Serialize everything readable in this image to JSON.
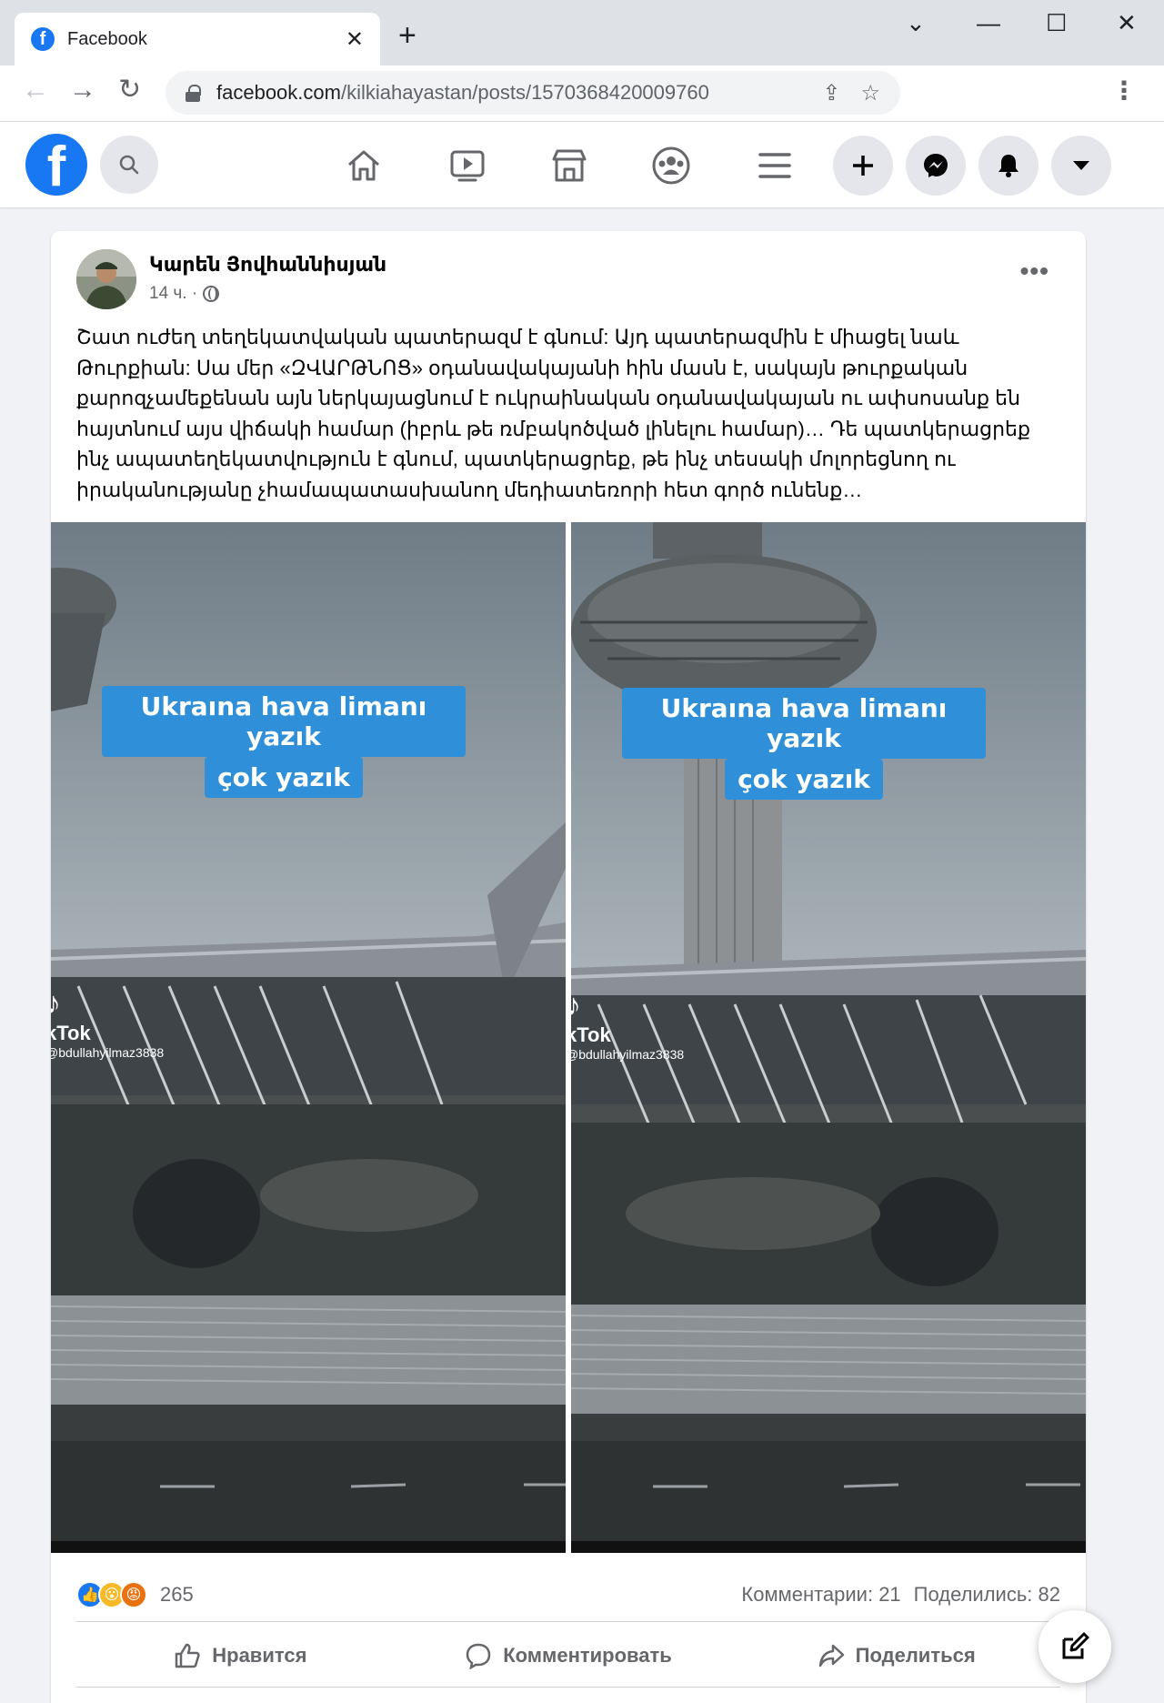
{
  "browser": {
    "tab_title": "Facebook",
    "tab_close": "✕",
    "new_tab": "+",
    "url_host": "facebook.com",
    "url_path": "/kilkiahayastan/posts/1570368420009760",
    "window_controls": [
      "⌄",
      "—",
      "☐",
      "✕"
    ]
  },
  "post": {
    "author": "Կարեն Յովհաննիսյան",
    "time": "14 ч. ·",
    "more": "•••",
    "text_lines": [
      "Շատ ուժեղ տեղեկատվական պատերազմ է գնում: Այդ պատերազմին է միացել նաև",
      "Թուրքիան: Սա մեր «ԶՎԱՐԹՆՈՑ» օդանավակայանի հին մասն է, սակայն թուրքական",
      "քարոզչամեքենան այն ներկայացնում է ուկրաինական օդանավակայան ու ափսոսանք են",
      "հայտնում այս վիճակի համար (իբրև թե ռմբակոծված լինելու համար)… Դե պատկերացրեք",
      "ինչ ապատեղեկատվություն է գնում, պատկերացրեք, թե ինչ տեսակի մոլորեցնող ու",
      "իրականությանը չհամապատասխանող  մեդիատեռորի հետ գործ ունենք…"
    ],
    "media": {
      "caption_line1": "Ukraına hava limanı yazık",
      "caption_line2": "çok yazık",
      "watermark_brand": "kTok",
      "watermark_user": "@bdullahyilmaz3838"
    },
    "reaction_count": "265",
    "comments": "Комментарии: 21",
    "shares": "Поделились: 82",
    "actions": {
      "like": "Нравится",
      "comment": "Комментировать",
      "share": "Поделиться"
    }
  },
  "colors": {
    "fb_blue": "#1877f2",
    "caption_bg": "#2f8fd8",
    "page_bg": "#f0f2f5"
  }
}
